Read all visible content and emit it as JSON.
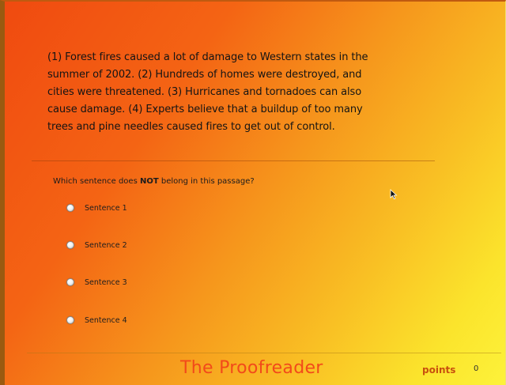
{
  "passage": {
    "lines": [
      "(1) Forest fires caused a lot of damage to Western states in the",
      "summer of 2002. (2) Hundreds of homes were destroyed, and",
      "cities were threatened. (3) Hurricanes and tornadoes can also",
      "cause damage. (4) Experts believe that a buildup of too many",
      "trees and pine needles caused fires to get out of control."
    ]
  },
  "question": {
    "before": "Which sentence does ",
    "emphasis": "NOT",
    "after": " belong in this passage?"
  },
  "options": [
    {
      "label": "Sentence 1"
    },
    {
      "label": "Sentence 2"
    },
    {
      "label": "Sentence 3"
    },
    {
      "label": "Sentence 4"
    }
  ],
  "footer": {
    "title": "The Proofreader",
    "points_label": "points",
    "points_value": "0"
  },
  "colors": {
    "background_start": "#f04a10",
    "background_end": "#fdf23a",
    "title": "#f24a1a",
    "points_label": "#c8500e"
  },
  "icons": {
    "radio": "radio-button-icon",
    "cursor": "mouse-pointer-icon"
  }
}
